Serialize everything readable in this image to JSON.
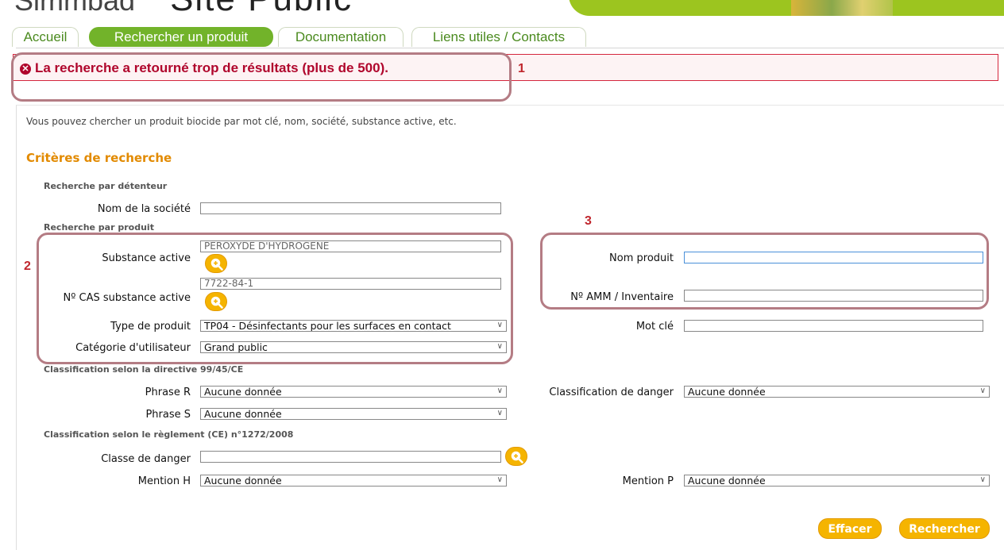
{
  "header": {
    "brand_left": "Simmbad",
    "brand_right": "Site Public"
  },
  "tabs": [
    {
      "label": "Accueil"
    },
    {
      "label": "Rechercher un produit",
      "active": true
    },
    {
      "label": "Documentation"
    },
    {
      "label": "Liens utiles / Contacts"
    }
  ],
  "error": {
    "icon": "error-circle-icon",
    "message": "La recherche a retourné trop de résultats (plus de 500)."
  },
  "callouts": {
    "one": "1",
    "two": "2",
    "three": "3"
  },
  "intro": "Vous pouvez chercher un produit biocide par mot clé, nom, société, substance active, etc.",
  "criteria_title": "Critères de recherche",
  "sections": {
    "holder": "Recherche par détenteur",
    "product": "Recherche par produit",
    "directive": "Classification selon la directive 99/45/CE",
    "regulation": "Classification selon le règlement (CE) n°1272/2008"
  },
  "fields": {
    "company_label": "Nom de la société",
    "company_value": "",
    "substance_label": "Substance active",
    "substance_value": "PEROXYDE D'HYDROGENE",
    "cas_label": "Nº CAS substance active",
    "cas_value": "7722-84-1",
    "type_label": "Type de produit",
    "type_value": "TP04 - Désinfectants pour les surfaces en contact",
    "category_label": "Catégorie d'utilisateur",
    "category_value": "Grand public",
    "product_name_label": "Nom produit",
    "product_name_value": "",
    "amm_label": "Nº AMM / Inventaire",
    "amm_value": "",
    "keyword_label": "Mot clé",
    "keyword_value": "",
    "phrase_r_label": "Phrase R",
    "phrase_r_value": "Aucune donnée",
    "phrase_s_label": "Phrase S",
    "phrase_s_value": "Aucune donnée",
    "danger_class_label": "Classification de danger",
    "danger_class_value": "Aucune donnée",
    "hazard_class_label": "Classe de danger",
    "hazard_class_value": "",
    "mention_h_label": "Mention H",
    "mention_h_value": "Aucune donnée",
    "mention_p_label": "Mention P",
    "mention_p_value": "Aucune donnée"
  },
  "buttons": {
    "clear": "Effacer",
    "search": "Rechercher"
  },
  "colors": {
    "brand_green": "#72b32a",
    "error_red": "#b0062c",
    "accent_orange": "#e28a00",
    "button_yellow": "#f5b400",
    "callout": "#b47c84"
  }
}
